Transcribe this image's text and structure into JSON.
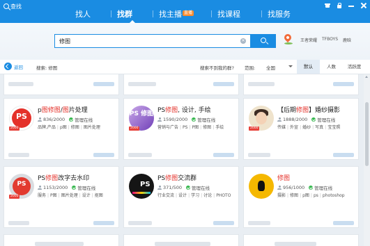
{
  "window": {
    "title": "查找"
  },
  "nav": {
    "tabs": [
      {
        "label": "找人"
      },
      {
        "label": "找群"
      },
      {
        "label": "找主播",
        "badge": "直播"
      },
      {
        "label": "找课程"
      },
      {
        "label": "找服务"
      }
    ],
    "active_index": 1
  },
  "window_controls": [
    "skin-icon",
    "lock-icon",
    "minimize-icon",
    "close-icon"
  ],
  "search": {
    "value": "修图",
    "hot_words": [
      "王者荣耀",
      "TFBOYS",
      "鹿晗"
    ]
  },
  "filter_bar": {
    "back_label": "返回",
    "search_label": "搜索: 修图",
    "not_found_label": "搜索不到我的群?",
    "range_label": "范围:",
    "range_value": "全国",
    "sort_tabs": [
      "默认",
      "人数",
      "活跃度"
    ],
    "sort_active": 0
  },
  "colors": {
    "brand_blue": "#1a8ce2",
    "keyword_red": "#e4312a",
    "online_green": "#35b74d"
  },
  "groups": [
    {
      "name_parts": [
        {
          "text": "p",
          "hl": false
        },
        {
          "text": "图修图",
          "hl": true
        },
        {
          "text": "/",
          "hl": false
        },
        {
          "text": "图",
          "hl": true
        },
        {
          "text": "片处理",
          "hl": false
        }
      ],
      "members": "836/2000",
      "status": "管理在线",
      "tags": [
        "品牌,产品",
        "p图",
        "修图",
        "图片处理"
      ],
      "badge": "2000",
      "avatar": "red-ps-logo",
      "avatar_text": "PS"
    },
    {
      "name_parts": [
        {
          "text": "PS",
          "hl": false
        },
        {
          "text": "修图",
          "hl": true
        },
        {
          "text": ", 设计, 手绘",
          "hl": false
        }
      ],
      "members": "1590/2000",
      "status": "管理在线",
      "tags": [
        "营销与广告",
        "PS",
        "P图",
        "修图",
        "手绘"
      ],
      "badge": "2000",
      "avatar": "purple-ps-logo",
      "avatar_text": "PS 修图"
    },
    {
      "name_parts": [
        {
          "text": "【后期",
          "hl": false
        },
        {
          "text": "修图",
          "hl": true
        },
        {
          "text": "】婚纱摄影",
          "hl": false
        }
      ],
      "members": "1888/2000",
      "status": "管理在线",
      "tags": [
        "传媒",
        "外宣",
        "婚纱",
        "写真",
        "宝宝照"
      ],
      "badge": "2000",
      "avatar": "cartoon-girl",
      "avatar_text": ""
    },
    {
      "name_parts": [
        {
          "text": "PS",
          "hl": false
        },
        {
          "text": "修图",
          "hl": true
        },
        {
          "text": "改字去水印",
          "hl": false
        }
      ],
      "members": "1153/2000",
      "status": "管理在线",
      "tags": [
        "服务",
        "P图",
        "图片处理",
        "设计",
        "抠图"
      ],
      "badge": "2000",
      "avatar": "gray-ps-logo",
      "avatar_text": "PS"
    },
    {
      "name_parts": [
        {
          "text": "PS",
          "hl": false
        },
        {
          "text": "修图",
          "hl": true
        },
        {
          "text": "交流群",
          "hl": false
        }
      ],
      "members": "371/500",
      "status": "管理在线",
      "tags": [
        "行业交流",
        "设计",
        "学习",
        "讨论",
        "PHOTO"
      ],
      "badge": "",
      "avatar": "dark-ps-logo",
      "avatar_text": "PS"
    },
    {
      "name_parts": [
        {
          "text": "修图",
          "hl": true
        }
      ],
      "members": "956/1000",
      "status": "管理在线",
      "tags": [
        "摄影",
        "修图",
        "p图",
        "ps",
        "photoshop"
      ],
      "badge": "",
      "avatar": "yellow-blob",
      "avatar_text": ""
    }
  ]
}
